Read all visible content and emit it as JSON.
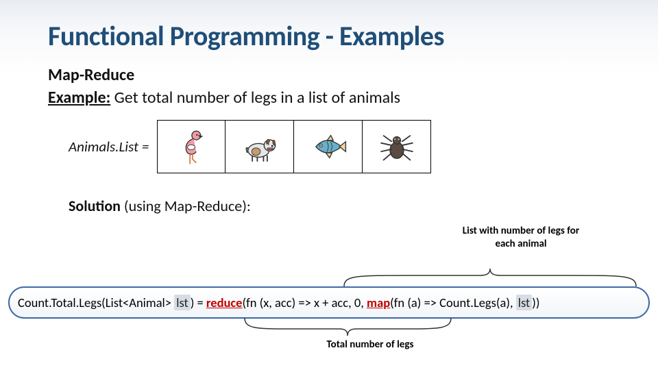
{
  "title": "Functional Programming - Examples",
  "subtitle": "Map-Reduce",
  "example": {
    "label": "Example:",
    "text": " Get total number of legs in a list of animals"
  },
  "animals_label": "Animals.List = ",
  "animals": [
    "flamingo",
    "dog",
    "fish",
    "spider"
  ],
  "solution": {
    "prefix": "Solution",
    "suffix": " (using Map-Reduce):"
  },
  "annot_right_l1": "List with number of legs for",
  "annot_right_l2": "each animal",
  "annot_bottom": "Total number of legs",
  "code": {
    "p1": "Count.Total.Legs(List<Animal> ",
    "lst1": "lst",
    "p2": ") = ",
    "reduce": "reduce",
    "p3": "(fn (x, acc) => x + acc, 0, ",
    "map": "map",
    "p4": "(fn (a) => Count.Legs(a), ",
    "lst2": "lst",
    "p5": "))"
  }
}
